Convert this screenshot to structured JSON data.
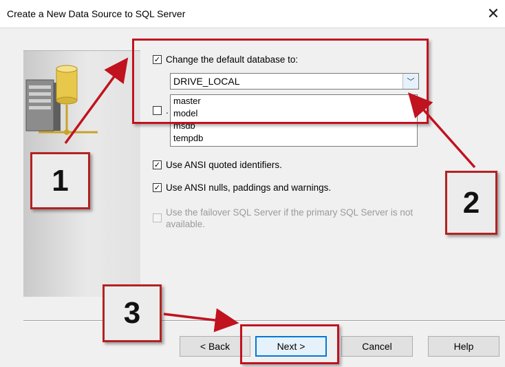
{
  "window": {
    "title": "Create a New Data Source to SQL Server",
    "close_glyph": "✕"
  },
  "options": {
    "change_default_db": {
      "label": "Change the default database to:",
      "checked": true
    },
    "hidden_partial_label": ".",
    "ansi_quoted": {
      "label": "Use ANSI quoted identifiers.",
      "checked": true
    },
    "ansi_nulls": {
      "label": "Use ANSI nulls, paddings and warnings.",
      "checked": true
    },
    "failover": {
      "line1": "Use the failover SQL Server if the primary SQL Server is not",
      "line2": "available.",
      "checked": false,
      "enabled": false
    }
  },
  "combo": {
    "value": "DRIVE_LOCAL",
    "options": [
      "master",
      "model",
      "msdb",
      "tempdb"
    ]
  },
  "buttons": {
    "back": "< Back",
    "next": "Next >",
    "cancel": "Cancel",
    "help": "Help"
  },
  "annotations": {
    "label1": "1",
    "label2": "2",
    "label3": "3"
  },
  "colors": {
    "annotation_red": "#c1121f",
    "accent_blue": "#0078d7"
  },
  "icons": {
    "server": "server-database-icon",
    "checkmark": "✓",
    "dropdown_arrow": "chevron-down-icon"
  }
}
